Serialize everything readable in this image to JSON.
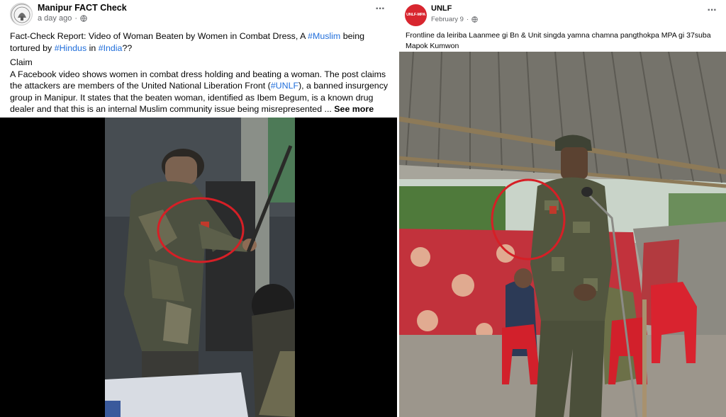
{
  "left_post": {
    "page_name": "Manipur FACT Check",
    "timestamp": "a day ago",
    "separator": "·",
    "privacy_icon": "globe-icon",
    "more_icon": "ellipsis-icon",
    "title_line": {
      "pre": "Fact-Check Report: Video of Woman Beaten by Women in Combat Dress, A ",
      "tag1": "#Muslim",
      "mid1": " being tortured by ",
      "tag2": "#Hindus",
      "mid2": " in ",
      "tag3": "#India",
      "end": "??"
    },
    "claim_heading": "Claim",
    "claim_text": {
      "pre": "A Facebook video shows women in combat dress holding and beating a woman. The post claims the attackers are members of the United National Liberation Front (",
      "tag": "#UNLF",
      "post": "), a banned insurgency group in Manipur. It states that the beaten woman, identified as Ibem Begum, is a known drug dealer and that this is an internal Muslim community issue being misrepresented ... ",
      "see_more": "See more"
    }
  },
  "right_post": {
    "page_name": "UNLF",
    "avatar_text": "UNLF-MPA",
    "timestamp": "February 9",
    "separator": "·",
    "privacy_icon": "globe-icon",
    "more_icon": "ellipsis-icon",
    "caption": "Frontline da leiriba Laanmee gi Bn & Unit singda yamna chamna pangthokpa MPA gi 37suba Mapok Kumwon"
  },
  "colors": {
    "link": "#216fdb",
    "highlight_circle": "#d61f26",
    "meta_text": "#65676b"
  }
}
